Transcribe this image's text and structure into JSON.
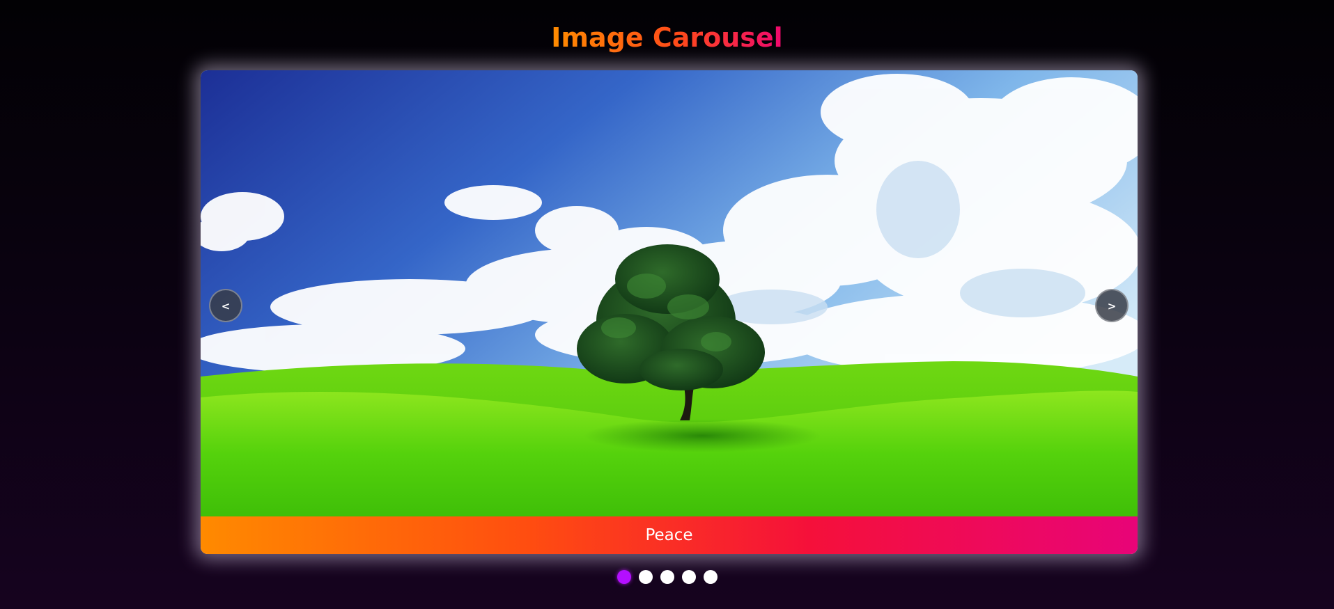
{
  "page": {
    "title": "Image Carousel"
  },
  "carousel": {
    "current_slide": {
      "caption": "Peace",
      "image": "green-hill-lone-tree-blue-sky"
    },
    "prev_label": "<",
    "next_label": ">",
    "slide_count": 5,
    "active_index": 0
  },
  "colors": {
    "title_gradient": [
      "#ff8c00",
      "#f0086e"
    ],
    "caption_gradient": [
      "#ff8a00",
      "#e80478"
    ],
    "active_dot": "#b40fff",
    "inactive_dot": "#ffffff",
    "background": "#0a0210"
  }
}
